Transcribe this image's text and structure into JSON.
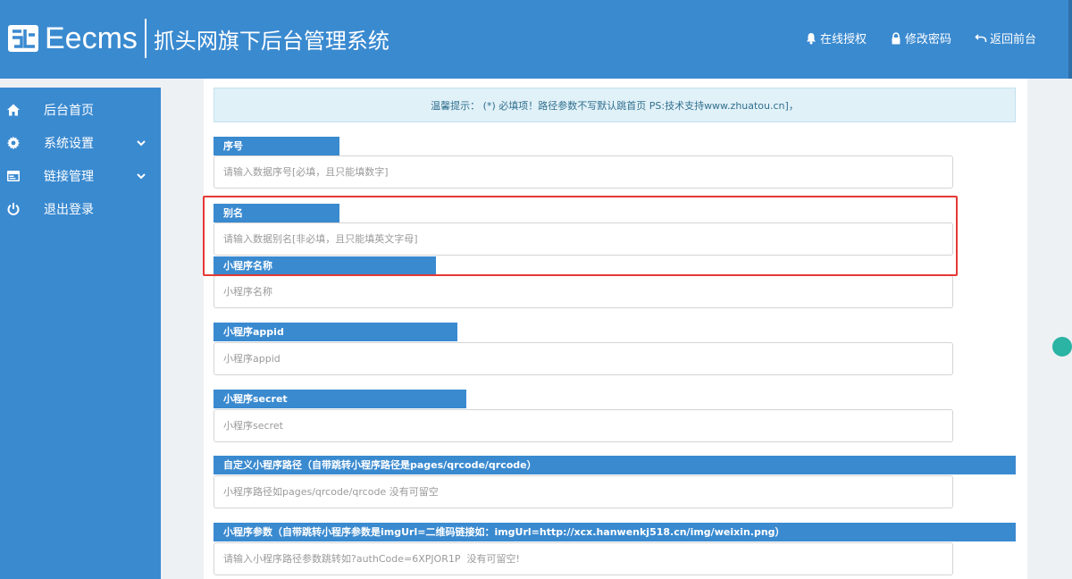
{
  "header": {
    "logo_text": "Eecms",
    "subtitle": "抓头网旗下后台管理系统",
    "nav": [
      {
        "label": "在线授权",
        "icon": "bell-icon"
      },
      {
        "label": "修改密码",
        "icon": "lock-icon"
      },
      {
        "label": "返回前台",
        "icon": "undo-icon"
      }
    ]
  },
  "sidebar": {
    "items": [
      {
        "label": "后台首页",
        "icon": "home-icon"
      },
      {
        "label": "系统设置",
        "icon": "gear-icon",
        "expandable": true
      },
      {
        "label": "链接管理",
        "icon": "window-icon",
        "expandable": true
      },
      {
        "label": "退出登录",
        "icon": "power-icon"
      }
    ]
  },
  "tip": "温馨提示： (*) 必填项！路径参数不写默认跳首页 PS:技术支持www.zhuatou.cn]，",
  "fields": [
    {
      "label": "序号",
      "placeholder": "请输入数据序号[必填，且只能填数字]",
      "value": ""
    },
    {
      "label": "别名",
      "placeholder": "请输入数据别名[非必填，且只能填英文字母]",
      "value": ""
    },
    {
      "label": "小程序名称",
      "placeholder": "小程序名称",
      "value": ""
    },
    {
      "label": "小程序appid",
      "placeholder": "小程序appid",
      "value": ""
    },
    {
      "label": "小程序secret",
      "placeholder": "小程序secret",
      "value": ""
    },
    {
      "label": "自定义小程序路径（自带跳转小程序路径是pages/qrcode/qrcode）",
      "placeholder": "小程序路径如pages/qrcode/qrcode 没有可留空",
      "value": ""
    },
    {
      "label": "小程序参数（自带跳转小程序参数是imgUrl=二维码链接如：imgUrl=http://xcx.hanwenkj518.cn/img/weixin.png）",
      "placeholder": "请输入小程序路径参数跳转如?authCode=6XPJOR1P  没有可留空!",
      "value": ""
    }
  ],
  "colors": {
    "primary": "#3a8ad0",
    "tip_bg": "#e1f1f8",
    "highlight": "#e53935"
  }
}
